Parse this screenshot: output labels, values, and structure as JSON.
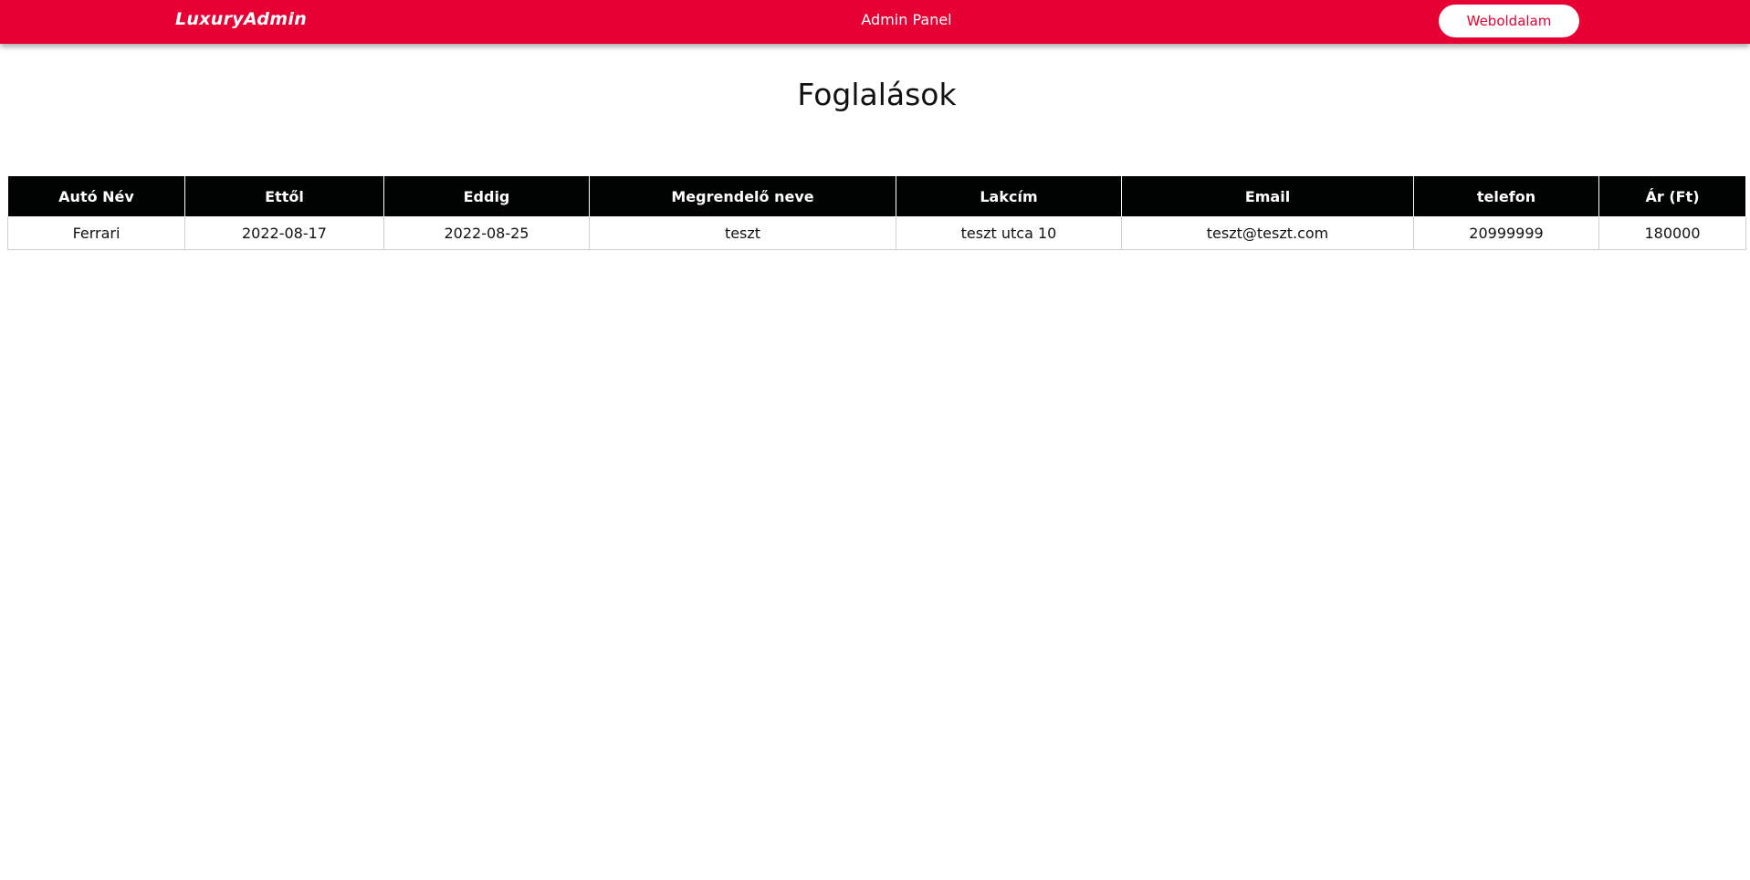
{
  "header": {
    "logo_text": "LuxuryAdmin",
    "center_title": "Admin Panel",
    "site_button_label": "Weboldalam",
    "background_color": "#e60033"
  },
  "page": {
    "title": "Foglalások"
  },
  "table": {
    "columns": [
      "Autó Név",
      "Ettől",
      "Eddig",
      "Megrendelő neve",
      "Lakcím",
      "Email",
      "telefon",
      "Ár (Ft)"
    ],
    "rows": [
      [
        "Ferrari",
        "2022-08-17",
        "2022-08-25",
        "teszt",
        "teszt utca 10",
        "teszt@teszt.com",
        "20999999",
        "180000"
      ]
    ]
  }
}
